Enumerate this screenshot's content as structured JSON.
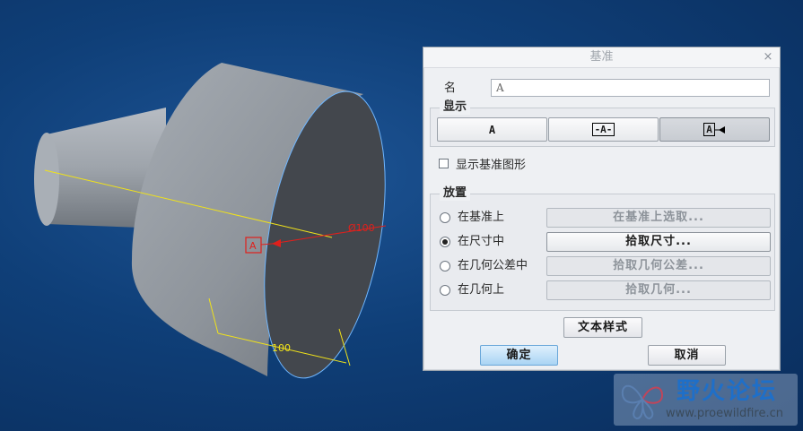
{
  "viewport": {
    "model_name": "3d-stepped-cylinder",
    "dimension_diameter": "Ø100",
    "dimension_length": "100",
    "datum_tag": "A"
  },
  "dialog": {
    "title": "基准",
    "close_glyph": "×",
    "name_label": "名称",
    "name_value": "A",
    "display_group_title": "显示",
    "display_options": [
      "A",
      "-A-",
      "A"
    ],
    "display_selected_index": 2,
    "show_datum_shape_label": "显示基准图形",
    "show_datum_shape_checked": false,
    "placement_group_title": "放置",
    "placement_options": [
      {
        "label": "在基准上",
        "action": "在基准上选取...",
        "selected": false,
        "enabled": false
      },
      {
        "label": "在尺寸中",
        "action": "拾取尺寸...",
        "selected": true,
        "enabled": true
      },
      {
        "label": "在几何公差中",
        "action": "拾取几何公差...",
        "selected": false,
        "enabled": false
      },
      {
        "label": "在几何上",
        "action": "拾取几何...",
        "selected": false,
        "enabled": false
      }
    ],
    "text_style_label": "文本样式",
    "ok_label": "确定",
    "cancel_label": "取消"
  },
  "watermark": {
    "title": "野火论坛",
    "url": "www.proewildfire.cn"
  },
  "colors": {
    "background": "#0f3f78",
    "annotation_yellow": "#f0e21a",
    "datum_red": "#e0201c",
    "ok_button": "#a9d4f4"
  }
}
